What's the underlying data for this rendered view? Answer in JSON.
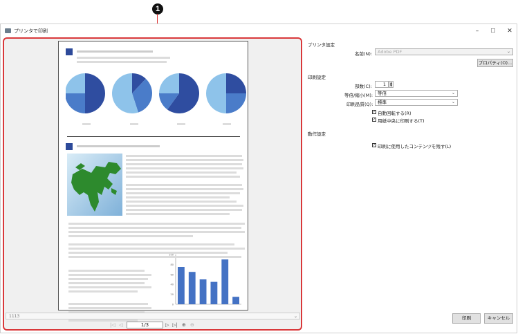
{
  "callout": {
    "number": "1"
  },
  "window": {
    "title": "プリンタで印刷",
    "controls": {
      "minimize": "–",
      "maximize": "☐",
      "close": "✕"
    }
  },
  "preview": {
    "document_select_value": "1113",
    "page_indicator": "1/3",
    "nav": {
      "first": "|◁",
      "prev": "◁",
      "next": "▷",
      "last": "▷|",
      "zoom_in": "⊕",
      "zoom_out": "⊖"
    },
    "pie_slices": [
      [
        {
          "value": 0.5,
          "color": "#2f4da0"
        },
        {
          "value": 0.25,
          "color": "#4a7cc9"
        },
        {
          "value": 0.25,
          "color": "#8ec3ea"
        }
      ],
      [
        {
          "value": 0.12,
          "color": "#2f4da0"
        },
        {
          "value": 0.33,
          "color": "#4a7cc9"
        },
        {
          "value": 0.55,
          "color": "#8ec3ea"
        }
      ],
      [
        {
          "value": 0.6,
          "color": "#2f4da0"
        },
        {
          "value": 0.15,
          "color": "#4a7cc9"
        },
        {
          "value": 0.25,
          "color": "#8ec3ea"
        }
      ],
      [
        {
          "value": 0.25,
          "color": "#2f4da0"
        },
        {
          "value": 0.25,
          "color": "#4a7cc9"
        },
        {
          "value": 0.5,
          "color": "#8ec3ea"
        }
      ]
    ],
    "mini_chart": {
      "y_ticks": [
        "0",
        "20",
        "40",
        "60",
        "80",
        "100"
      ],
      "values": [
        75,
        65,
        50,
        45,
        90,
        15
      ],
      "ylim": [
        0,
        100
      ],
      "bar_color": "#4472c4"
    }
  },
  "settings": {
    "printer_section": "プリンタ設定",
    "name_label": "名前(N):",
    "name_value": "Adobe PDF",
    "properties_button": "プロパティ(O)...",
    "print_section": "印刷設定",
    "copies_label": "部数(C):",
    "copies_value": "1",
    "scale_label": "等倍/縮小(M):",
    "scale_value": "等倍",
    "quality_label": "印刷品質(Q):",
    "quality_value": "標準",
    "auto_rotate": "自動回転する(R)",
    "center_on_paper": "用紙中央に印刷する(T)",
    "action_section": "動作設定",
    "keep_content": "印刷に使用したコンテンツを残す(L)",
    "print_button": "印刷",
    "cancel_button": "キャンセル"
  }
}
